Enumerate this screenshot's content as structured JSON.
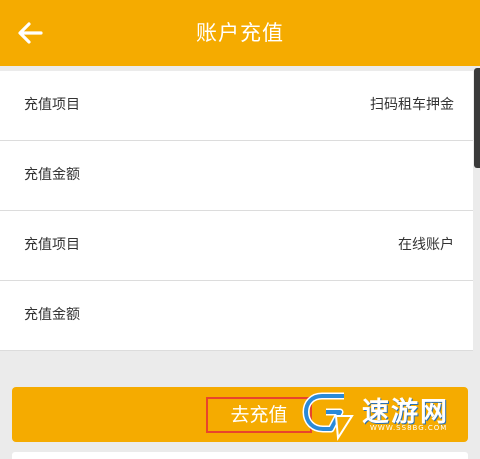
{
  "header": {
    "title": "账户充值",
    "back_icon": "arrow-left-icon"
  },
  "rows": [
    {
      "label": "充值项目",
      "value": "扫码租车押金"
    },
    {
      "label": "充值金额",
      "value": ""
    },
    {
      "label": "充值项目",
      "value": "在线账户"
    },
    {
      "label": "充值金额",
      "value": ""
    }
  ],
  "submit": {
    "label": "去充值"
  },
  "watermark": {
    "name": "速游网",
    "url": "WWW.SS8BG.COM"
  },
  "colors": {
    "accent": "#f5ab00",
    "highlight_border": "#e8452c",
    "text": "#333333"
  }
}
